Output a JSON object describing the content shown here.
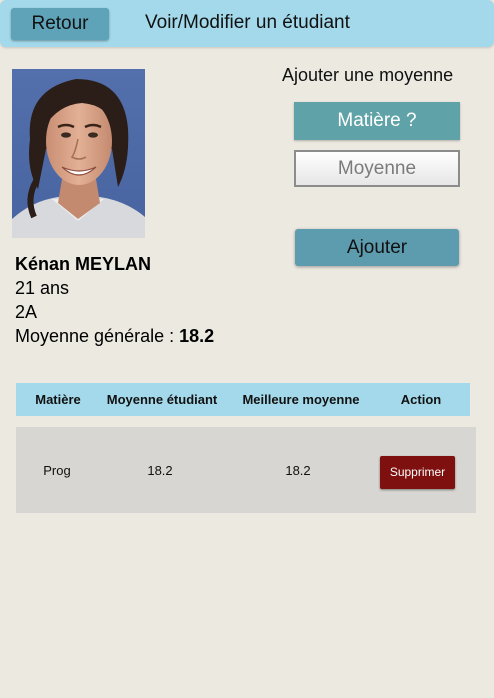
{
  "header": {
    "back_label": "Retour",
    "title": "Voir/Modifier un étudiant"
  },
  "student": {
    "name": "Kénan MEYLAN",
    "age": "21 ans",
    "class": "2A",
    "average_label": "Moyenne générale : ",
    "average_value": "18.2"
  },
  "add_form": {
    "title": "Ajouter une moyenne",
    "subject_select_label": "Matière ?",
    "average_placeholder": "Moyenne",
    "submit_label": "Ajouter"
  },
  "table": {
    "headers": [
      "Matière",
      "Moyenne étudiant",
      "Meilleure moyenne",
      "Action"
    ],
    "rows": [
      {
        "subject": "Prog",
        "student_average": "18.2",
        "best_average": "18.2",
        "action_label": "Supprimer"
      }
    ]
  },
  "colors": {
    "header_bg": "#a3d9ea",
    "page_bg": "#ece9e1",
    "button_primary": "#5fa3b8",
    "delete_button": "#7e1010",
    "row_bg": "#d8d6d2"
  }
}
